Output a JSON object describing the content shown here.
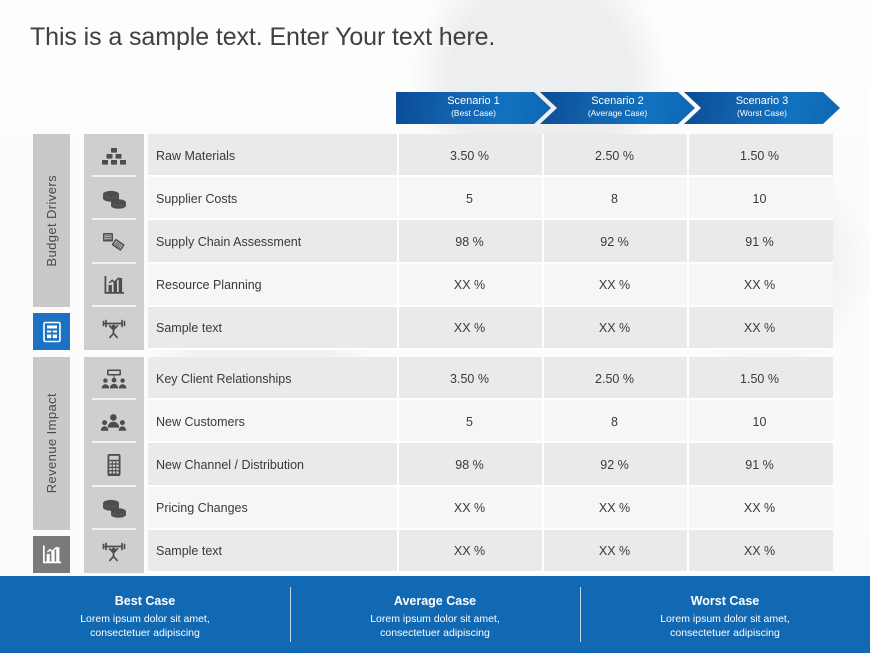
{
  "title": "This is a sample text. Enter Your text here.",
  "colors": {
    "chevron_blue": "#0e66b2",
    "footer_blue": "#1168b3",
    "band_gray": "#c9c9c9",
    "tile_blue": "#1b72c4",
    "tile_gray": "#7a7a7a",
    "icon_col_gray": "#cfcfcf",
    "row_odd": "#e9eaeb",
    "row_even": "#f5f6f7"
  },
  "scenarios": [
    {
      "name": "Scenario 1",
      "case": "(Best Case)"
    },
    {
      "name": "Scenario 2",
      "case": "(Average Case)"
    },
    {
      "name": "Scenario 3",
      "case": "(Worst Case)"
    }
  ],
  "sections": [
    {
      "band_label": "Budget Drivers",
      "tile_icon": "report-document-icon",
      "tile_style": "blue",
      "rows": [
        {
          "icon": "blocks-pyramid-icon",
          "label": "Raw Materials",
          "values": [
            "3.50 %",
            "2.50 %",
            "1.50 %"
          ]
        },
        {
          "icon": "coins-stack-icon",
          "label": "Supplier Costs",
          "values": [
            "5",
            "8",
            "10"
          ]
        },
        {
          "icon": "tiles-blocks-icon",
          "label": "Supply Chain Assessment",
          "values": [
            "98 %",
            "92 %",
            "91 %"
          ]
        },
        {
          "icon": "bar-chart-icon",
          "label": "Resource Planning",
          "values": [
            "XX %",
            "XX %",
            "XX %"
          ]
        },
        {
          "icon": "person-lifting-icon",
          "label": "Sample text",
          "values": [
            "XX %",
            "XX %",
            "XX %"
          ]
        }
      ]
    },
    {
      "band_label": "Revenue Impact",
      "tile_icon": "bar-chart-icon",
      "tile_style": "gray",
      "rows": [
        {
          "icon": "meeting-presentation-icon",
          "label": "Key Client Relationships",
          "values": [
            "3.50 %",
            "2.50 %",
            "1.50 %"
          ]
        },
        {
          "icon": "customers-group-icon",
          "label": "New Customers",
          "values": [
            "5",
            "8",
            "10"
          ]
        },
        {
          "icon": "calculator-device-icon",
          "label": "New Channel / Distribution",
          "values": [
            "98 %",
            "92 %",
            "91 %"
          ]
        },
        {
          "icon": "coins-stack-icon",
          "label": "Pricing Changes",
          "values": [
            "XX %",
            "XX %",
            "XX %"
          ]
        },
        {
          "icon": "person-lifting-icon",
          "label": "Sample text",
          "values": [
            "XX %",
            "XX %",
            "XX %"
          ]
        }
      ]
    }
  ],
  "footer": [
    {
      "title": "Best Case",
      "line1": "Lorem  ipsum dolor sit amet,",
      "line2": "consectetuer  adipiscing"
    },
    {
      "title": "Average Case",
      "line1": "Lorem  ipsum dolor sit amet,",
      "line2": "consectetuer  adipiscing"
    },
    {
      "title": "Worst Case",
      "line1": "Lorem  ipsum dolor sit amet,",
      "line2": "consectetuer  adipiscing"
    }
  ]
}
